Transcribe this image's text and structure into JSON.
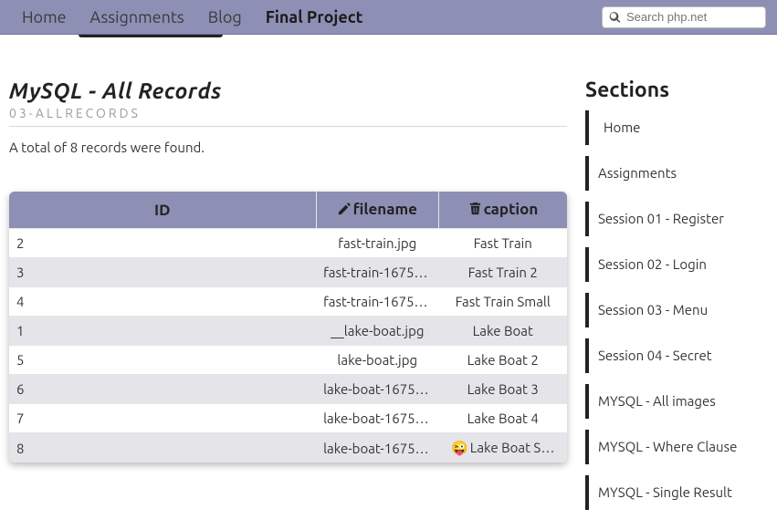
{
  "topnav": {
    "items": [
      {
        "label": "Home"
      },
      {
        "label": "Assignments"
      },
      {
        "label": "Blog"
      },
      {
        "label": "Final Project"
      }
    ],
    "active_index": 3
  },
  "search": {
    "placeholder": "Search php.net"
  },
  "page": {
    "title": "MySQL - All Records",
    "subtitle": "03-ALLRECORDS",
    "total_text": "A total of 8 records were found."
  },
  "table": {
    "headers": {
      "id": "ID",
      "filename": "filename",
      "caption": "caption"
    },
    "rows": [
      {
        "id": "2",
        "filename": "fast-train.jpg",
        "caption": "Fast Train"
      },
      {
        "id": "3",
        "filename": "fast-train-16753…",
        "caption": "Fast Train 2"
      },
      {
        "id": "4",
        "filename": "fast-train-16753…",
        "caption": "Fast Train Small"
      },
      {
        "id": "1",
        "filename": "__lake-boat.jpg",
        "caption": "Lake Boat"
      },
      {
        "id": "5",
        "filename": "lake-boat.jpg",
        "caption": "Lake Boat 2"
      },
      {
        "id": "6",
        "filename": "lake-boat-16753…",
        "caption": "Lake Boat 3"
      },
      {
        "id": "7",
        "filename": "lake-boat-16753…",
        "caption": "Lake Boat 4"
      },
      {
        "id": "8",
        "filename": "lake-boat-16753…",
        "caption": "Lake Boat S…",
        "emoji": "😜"
      }
    ]
  },
  "sidebar": {
    "title": "Sections",
    "items": [
      {
        "label": "Home",
        "active": true
      },
      {
        "label": "Assignments"
      },
      {
        "label": "Session 01 - Register"
      },
      {
        "label": "Session 02 - Login"
      },
      {
        "label": "Session 03 - Menu"
      },
      {
        "label": "Session 04 - Secret"
      },
      {
        "label": "MYSQL - All images"
      },
      {
        "label": "MYSQL - Where Clause"
      },
      {
        "label": "MYSQL - Single Result"
      }
    ]
  }
}
